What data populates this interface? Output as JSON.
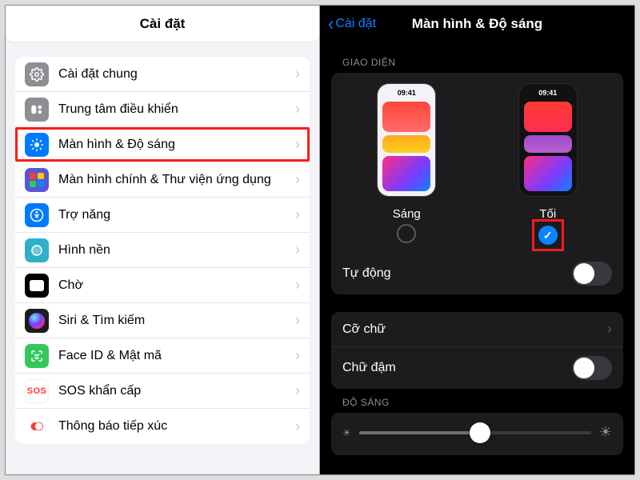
{
  "left": {
    "title": "Cài đặt",
    "items": [
      {
        "label": "Cài đặt chung",
        "icon": "gear-icon",
        "icon_class": "bg-grey"
      },
      {
        "label": "Trung tâm điều khiển",
        "icon": "control-center-icon",
        "icon_class": "bg-grey"
      },
      {
        "label": "Màn hình & Độ sáng",
        "icon": "brightness-icon",
        "icon_class": "bg-blue",
        "highlight": true
      },
      {
        "label": "Màn hình chính & Thư viện ứng dụng",
        "icon": "home-grid-icon",
        "icon_class": "bg-indigo"
      },
      {
        "label": "Trợ năng",
        "icon": "accessibility-icon",
        "icon_class": "bg-blue"
      },
      {
        "label": "Hình nền",
        "icon": "wallpaper-icon",
        "icon_class": "bg-teal"
      },
      {
        "label": "Chờ",
        "icon": "standby-icon",
        "icon_class": "bg-black"
      },
      {
        "label": "Siri & Tìm kiếm",
        "icon": "siri-icon",
        "icon_class": "bg-siri"
      },
      {
        "label": "Face ID & Mật mã",
        "icon": "faceid-icon",
        "icon_class": "bg-green"
      },
      {
        "label": "SOS khẩn cấp",
        "icon": "sos-icon",
        "icon_class": "bg-white"
      },
      {
        "label": "Thông báo tiếp xúc",
        "icon": "exposure-icon",
        "icon_class": "bg-orange"
      }
    ]
  },
  "right": {
    "back_label": "Cài đặt",
    "title": "Màn hình & Độ sáng",
    "appearance": {
      "section_label": "GIAO DIỆN",
      "preview_time": "09:41",
      "light_label": "Sáng",
      "dark_label": "Tối",
      "selected": "dark",
      "auto_label": "Tự động",
      "auto_on": false
    },
    "text": {
      "text_size_label": "Cỡ chữ",
      "bold_label": "Chữ đậm",
      "bold_on": false
    },
    "brightness": {
      "section_label": "ĐỘ SÁNG",
      "value_pct": 52
    }
  },
  "icons": {
    "sos_text": "SOS"
  }
}
